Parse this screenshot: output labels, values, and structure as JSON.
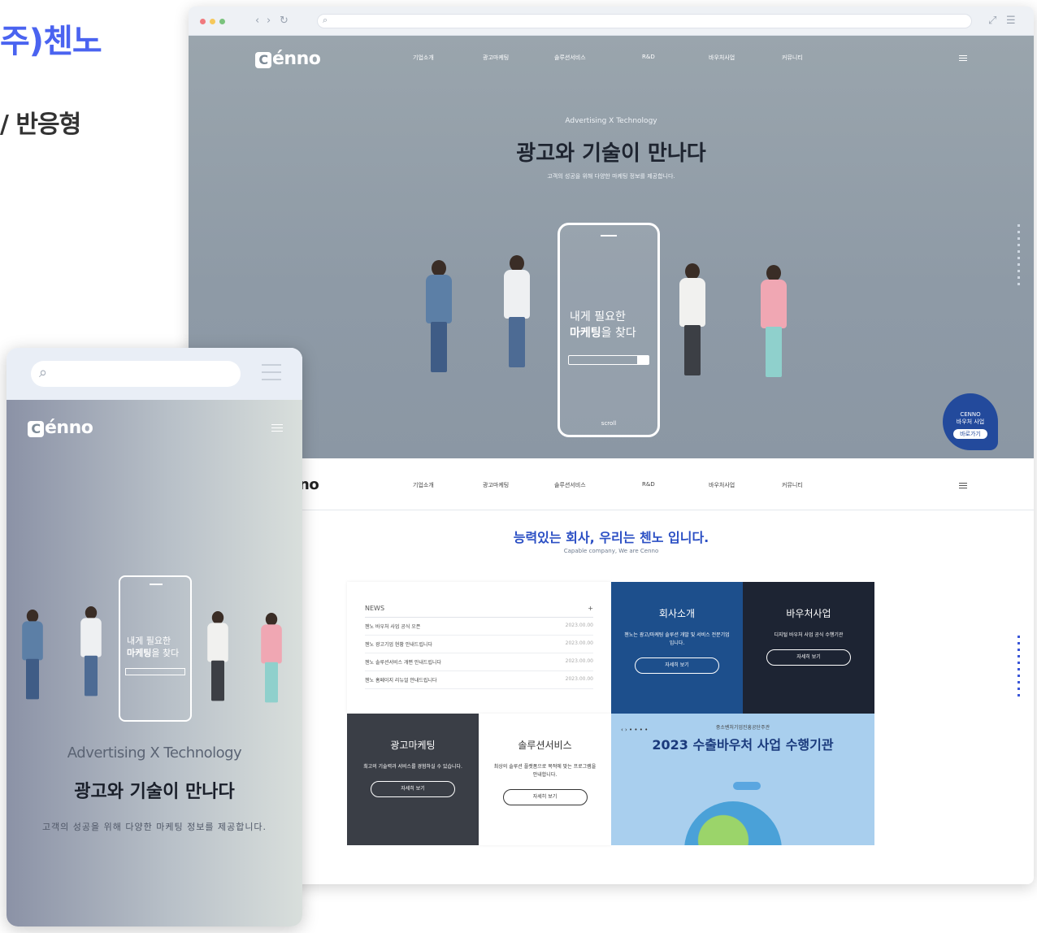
{
  "slide": {
    "title": "주)첸노",
    "subtitle": "/ 반응형"
  },
  "desktop": {
    "brand": "Cenno",
    "brand_letter": "C",
    "brand_rest": "énno",
    "nav": [
      "기업소개",
      "광고마케팅",
      "솔루션서비스",
      "R&D",
      "바우처사업",
      "커뮤니티"
    ],
    "hero": {
      "eyebrow": "Advertising X Technology",
      "title": "광고와 기술이 만나다",
      "desc": "고객의 성공을 위해 다양한 마케팅 정보를 제공합니다."
    },
    "phone": {
      "line1": "내게 필요한",
      "line2_bold": "마케팅",
      "line2_rest": "을 찾다",
      "footer": "scroll"
    },
    "badge": {
      "brand": "CENNO",
      "title": "바우처 사업",
      "btn": "바로가기"
    },
    "nav2_logo": "no",
    "section": {
      "title": "능력있는 회사, 우리는 첸노 입니다.",
      "subtitle": "Capable company, We are Cenno"
    },
    "news": {
      "header": "NEWS",
      "more": "+",
      "rows": [
        {
          "title": "첸노 바우처 사업 공식 오픈",
          "date": "2023.00.00"
        },
        {
          "title": "첸노 광고기업 현황 안내드립니다",
          "date": "2023.00.00"
        },
        {
          "title": "첸노 솔루션서비스 개편 안내드립니다",
          "date": "2023.00.00"
        },
        {
          "title": "첸노 홈페이지 리뉴얼 안내드립니다",
          "date": "2023.00.00"
        }
      ]
    },
    "cards": {
      "company": {
        "title": "회사소개",
        "desc": "첸노는 광고/마케팅 솔루션 개발 및 서비스 전문기업 입니다.",
        "btn": "자세히 보기"
      },
      "voucher": {
        "title": "바우처사업",
        "desc": "디지털 바우처 사업 공식 수행기관",
        "btn": "자세히 보기"
      },
      "marketing": {
        "title": "광고마케팅",
        "desc": "최고의 기술력과 서비스를 경험하실 수 있습니다.",
        "btn": "자세히 보기"
      },
      "solution": {
        "title": "솔루션서비스",
        "desc": "최상의 솔루션 플랫폼으로 목적에 맞는 프로그램을 안내합니다.",
        "btn": "자세히 보기"
      },
      "promo": {
        "controls": "‹ › • • • •",
        "pre": "중소벤처기업진흥공단주관",
        "title": "2023 수출바우처 사업 수행기관"
      }
    }
  },
  "mobile": {
    "search_icon": "search-icon",
    "brand_letter": "C",
    "brand_rest": "énno",
    "phone": {
      "line1": "내게 필요한",
      "line2_bold": "마케팅",
      "line2_rest": "을 찾다"
    },
    "eyebrow": "Advertising X Technology",
    "title": "광고와 기술이 만나다",
    "desc": "고객의 성공을 위해 다양한 마케팅 정보를 제공합니다."
  },
  "colors": {
    "accent": "#4a63f0",
    "hero_bg": "#8e9aa6",
    "blue": "#1d4f8c",
    "navy": "#1d2433"
  }
}
